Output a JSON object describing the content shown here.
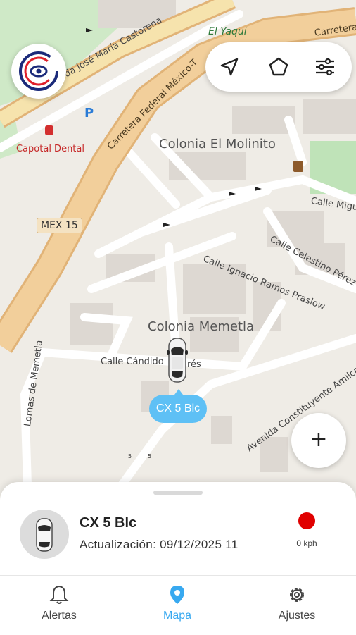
{
  "map": {
    "labels": {
      "road_jose_maria": "Avenida José María Castorena",
      "road_carretera_federal": "Carretera Federal México-T",
      "carretera_top": "Carretera",
      "el_yaqui": "El Yaqui",
      "capotal_dental": "Capotal Dental",
      "colonia_el_molinito": "Colonia El Molinito",
      "calle_migu": "Calle Migu",
      "mex15": "MEX 15",
      "calle_celestino": "Calle Celestino Pérez",
      "calle_ignacio": "Calle Ignacio Ramos Praslow",
      "colonia_memetla": "Colonia Memetla",
      "calle_candido": "Calle Cándido",
      "calle_candido_end": "rés",
      "lomas_memetla": "Lomas de Memetla",
      "avenida_constituyente": "Avenida Constituyente Amilcar"
    },
    "parking_symbol": "P",
    "colors": {
      "background": "#efece6",
      "highway": "#f2cf9b",
      "highway_edge": "#e1b377",
      "park": "#c7e8c2",
      "building": "#ddd8d2",
      "street": "#ffffff"
    }
  },
  "app_logo": {
    "name": "eye-target-logo",
    "colors": {
      "ring_blue": "#1b2a7a",
      "ring_red": "#e0202a"
    }
  },
  "toolbar": {
    "icons": [
      "navigation-arrow-icon",
      "polygon-icon",
      "sliders-icon"
    ]
  },
  "zoom_button": {
    "label": "+"
  },
  "vehicle_tag": {
    "label": "CX 5 Blc"
  },
  "vehicle_panel": {
    "name": "CX 5 Blc",
    "update_text": "Actualización: 09/12/2025 11",
    "speed": "0 kph",
    "status_color": "#e00000"
  },
  "bottom_nav": {
    "items": [
      {
        "label": "Alertas",
        "icon": "bell-icon",
        "active": false
      },
      {
        "label": "Mapa",
        "icon": "map-pin-icon",
        "active": true
      },
      {
        "label": "Ajustes",
        "icon": "gear-icon",
        "active": false
      }
    ],
    "active_color": "#38a9f0",
    "inactive_color": "#444444"
  }
}
